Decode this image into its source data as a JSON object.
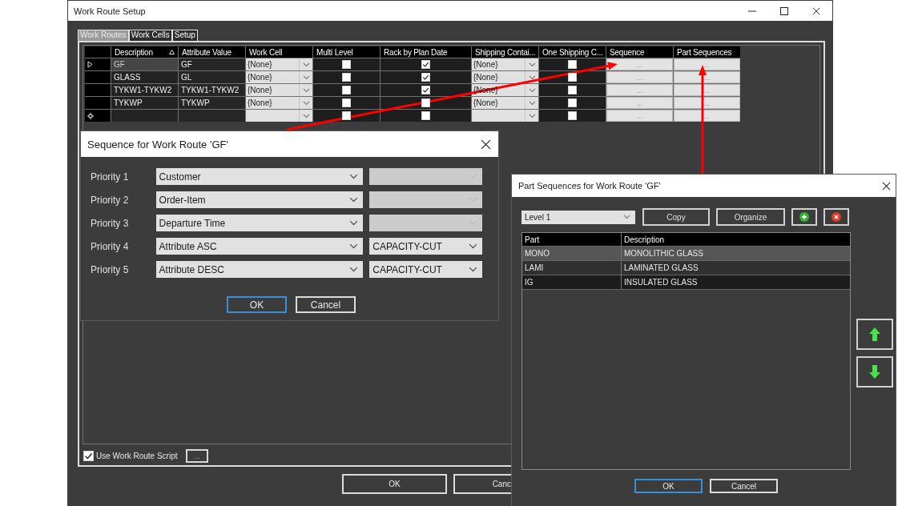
{
  "main_window": {
    "title": "Work Route Setup",
    "tabs": [
      {
        "label": "Work Routes",
        "selected": true
      },
      {
        "label": "Work Cells",
        "selected": false
      },
      {
        "label": "Setup",
        "selected": false
      }
    ],
    "grid": {
      "columns": [
        {
          "label": "Description",
          "sorted": true
        },
        {
          "label": "Attribute Value",
          "sorted": false
        },
        {
          "label": "Work Cell",
          "sorted": false
        },
        {
          "label": "Multi Level",
          "sorted": false
        },
        {
          "label": "Rack by Plan Date",
          "sorted": false
        },
        {
          "label": "Shipping Contai...",
          "sorted": false
        },
        {
          "label": "One Shipping C...",
          "sorted": false
        },
        {
          "label": "Sequence",
          "sorted": false
        },
        {
          "label": "Part Sequences",
          "sorted": false
        }
      ],
      "rows": [
        {
          "kind": "current",
          "selected": true,
          "description": "GF",
          "attribute_value": "GF",
          "work_cell": "{None}",
          "multi_level": false,
          "rack_by_plan_date": true,
          "shipping_container": "{None}",
          "one_shipping": false,
          "sequence": "...",
          "part_sequences": "..."
        },
        {
          "kind": "normal",
          "selected": false,
          "description": "GLASS",
          "attribute_value": "GL",
          "work_cell": "{None}",
          "multi_level": false,
          "rack_by_plan_date": true,
          "shipping_container": "{None}",
          "one_shipping": false,
          "sequence": "...",
          "part_sequences": "..."
        },
        {
          "kind": "normal",
          "selected": false,
          "description": "TYKW1-TYKW2",
          "attribute_value": "TYKW1-TYKW2",
          "work_cell": "{None}",
          "multi_level": false,
          "rack_by_plan_date": true,
          "shipping_container": "{None}",
          "one_shipping": false,
          "sequence": "...",
          "part_sequences": "..."
        },
        {
          "kind": "normal",
          "selected": false,
          "description": "TYKWP",
          "attribute_value": "TYKWP",
          "work_cell": "{None}",
          "multi_level": false,
          "rack_by_plan_date": false,
          "shipping_container": "{None}",
          "one_shipping": false,
          "sequence": "...",
          "part_sequences": "..."
        },
        {
          "kind": "new",
          "selected": false,
          "multi_level": false,
          "rack_by_plan_date": false,
          "one_shipping": false,
          "sequence": "...",
          "part_sequences": "..."
        }
      ]
    },
    "use_script": {
      "label": "Use Work Route Script",
      "checked": true
    },
    "script_button": "...",
    "buttons": [
      {
        "label": "OK",
        "kind": "full"
      },
      {
        "label": "Canc",
        "kind": "partial"
      }
    ]
  },
  "sequence_dialog": {
    "title": "Sequence for Work Route 'GF'",
    "priorities": [
      {
        "label": "Priority 1",
        "field": "Customer",
        "attribute_disabled": true
      },
      {
        "label": "Priority 2",
        "field": "Order-Item",
        "attribute_disabled": true
      },
      {
        "label": "Priority 3",
        "field": "Departure Time",
        "attribute_disabled": true
      },
      {
        "label": "Priority 4",
        "field": "Attribute ASC",
        "attribute": "CAPACITY-CUT",
        "attribute_disabled": false
      },
      {
        "label": "Priority 5",
        "field": "Attribute DESC",
        "attribute": "CAPACITY-CUT",
        "attribute_disabled": false
      }
    ],
    "buttons": [
      {
        "label": "OK",
        "default": true
      },
      {
        "label": "Cancel",
        "default": false
      }
    ]
  },
  "part_sequences_dialog": {
    "title": "Part Sequences for Work Route 'GF'",
    "level": "Level 1",
    "toolbar": [
      {
        "kind": "text",
        "label": "Copy"
      },
      {
        "kind": "text",
        "label": "Organize"
      },
      {
        "kind": "add"
      },
      {
        "kind": "remove"
      }
    ],
    "columns": [
      "Part",
      "Description"
    ],
    "rows": [
      {
        "part": "MONO",
        "description": "MONOLITHIC GLASS",
        "selected": true
      },
      {
        "part": "LAMI",
        "description": "LAMINATED GLASS",
        "selected": false
      },
      {
        "part": "IG",
        "description": "INSULATED GLASS",
        "selected": false
      }
    ],
    "move_buttons": [
      {
        "kind": "up"
      },
      {
        "kind": "down"
      }
    ],
    "buttons": [
      {
        "label": "OK",
        "default": true
      },
      {
        "label": "Cancel",
        "default": false
      }
    ]
  }
}
